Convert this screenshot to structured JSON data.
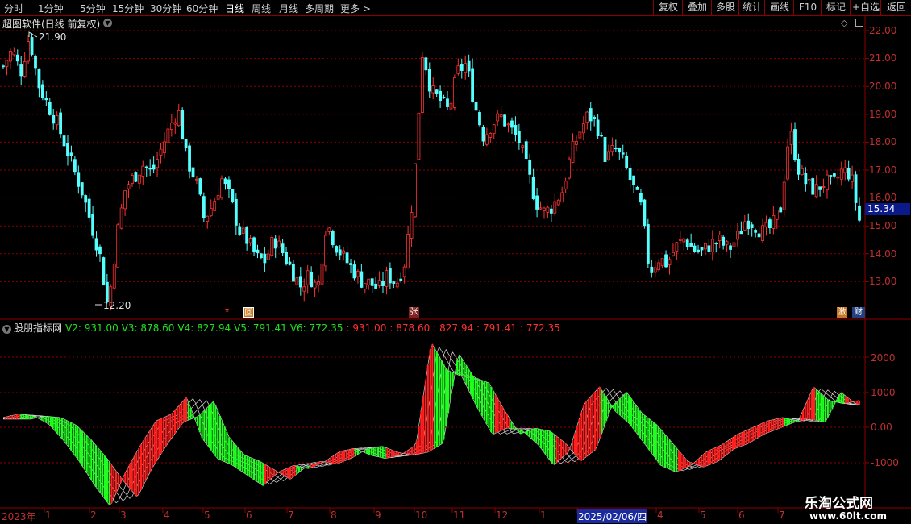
{
  "toolbar": {
    "periods": [
      "分时",
      "1分钟",
      "5分钟",
      "15分钟",
      "30分钟",
      "60分钟",
      "日线",
      "周线",
      "月线",
      "多周期",
      "更多 >"
    ],
    "active_period": "日线",
    "right_buttons": [
      "复权",
      "叠加",
      "多股",
      "统计",
      "画线",
      "F10",
      "标记",
      "+自选",
      "返回"
    ]
  },
  "main_chart": {
    "title": "超图软件(日线 前复权)",
    "high_label": "21.90",
    "low_label": "12.20",
    "current_price": "15.34",
    "y_ticks": [
      "22.00",
      "21.00",
      "20.00",
      "19.00",
      "18.00",
      "17.00",
      "16.00",
      "15.00",
      "14.00",
      "13.00"
    ],
    "markers": [
      "Ξ",
      "回",
      "张",
      "激",
      "财"
    ]
  },
  "indicator": {
    "name": "股朋指标网",
    "values_green": [
      "V2: 931.00",
      "V3: 878.60",
      "V4: 827.94",
      "V5: 791.41",
      "V6: 772.35"
    ],
    "values_red": [
      ": 931.00",
      ": 878.60",
      ": 827.94",
      ": 791.41",
      ": 772.35"
    ],
    "y_ticks": [
      "2000",
      "1000",
      "0.00",
      "-1000"
    ]
  },
  "x_axis": {
    "labels": [
      "2023年",
      "1",
      "2",
      "3",
      "4",
      "5",
      "6",
      "7",
      "8",
      "9",
      "10",
      "11",
      "12",
      "1",
      "2025/02/06/四",
      "4",
      "5",
      "6",
      "7"
    ]
  },
  "watermark": {
    "title": "乐淘公式网",
    "url": "www.60lt.com"
  },
  "colors": {
    "up": "#ff3232",
    "down": "#54ffff",
    "grid": "#8b0000",
    "ind_up": "#ff2020",
    "ind_down": "#20ff20"
  },
  "chart_data": {
    "type": "candlestick",
    "title": "超图软件(日线 前复权)",
    "ylim": [
      12.0,
      22.3
    ],
    "close_series": [
      20.8,
      21.4,
      20.6,
      21.9,
      20.2,
      19.5,
      18.9,
      18.1,
      17.2,
      16.4,
      15.3,
      14.2,
      12.2,
      14.8,
      16.5,
      16.9,
      17.3,
      17.0,
      17.8,
      18.6,
      19.3,
      17.5,
      16.8,
      15.4,
      15.9,
      16.8,
      16.1,
      15.0,
      14.6,
      14.0,
      13.9,
      14.7,
      14.2,
      13.6,
      13.0,
      13.4,
      12.9,
      15.3,
      14.5,
      14.0,
      13.6,
      13.2,
      13.1,
      12.9,
      13.4,
      13.1,
      13.9,
      16.5,
      21.4,
      19.9,
      19.6,
      19.2,
      20.6,
      20.9,
      19.4,
      18.3,
      18.8,
      19.0,
      18.6,
      18.2,
      17.1,
      16.0,
      15.6,
      15.9,
      16.4,
      17.7,
      18.5,
      19.1,
      18.7,
      17.5,
      17.9,
      17.4,
      16.6,
      15.8,
      13.5,
      14.0,
      13.8,
      14.4,
      14.7,
      14.3,
      14.2,
      14.5,
      14.6,
      14.3,
      14.7,
      15.4,
      15.2,
      14.9,
      15.1,
      15.8,
      18.6,
      17.2,
      16.6,
      16.4,
      16.7,
      16.6,
      17.1,
      17.0,
      15.34
    ]
  },
  "indicator_data": {
    "type": "line",
    "ylim": [
      -2200,
      2900
    ],
    "series_count": 5,
    "values": [
      400,
      500,
      450,
      200,
      -300,
      -900,
      -1600,
      -2200,
      -1200,
      -400,
      300,
      500,
      1000,
      -200,
      -800,
      -1000,
      -1300,
      -1600,
      -1200,
      -1000,
      -1100,
      -900,
      -600,
      -500,
      -700,
      -800,
      -700,
      -400,
      2600,
      1800,
      1600,
      700,
      -100,
      100,
      0,
      -400,
      -1000,
      -600,
      800,
      1300,
      600,
      200,
      -400,
      -1000,
      -1200,
      -1000,
      -600,
      -400,
      -100,
      100,
      300,
      400,
      300,
      1300,
      900,
      800,
      900
    ]
  }
}
